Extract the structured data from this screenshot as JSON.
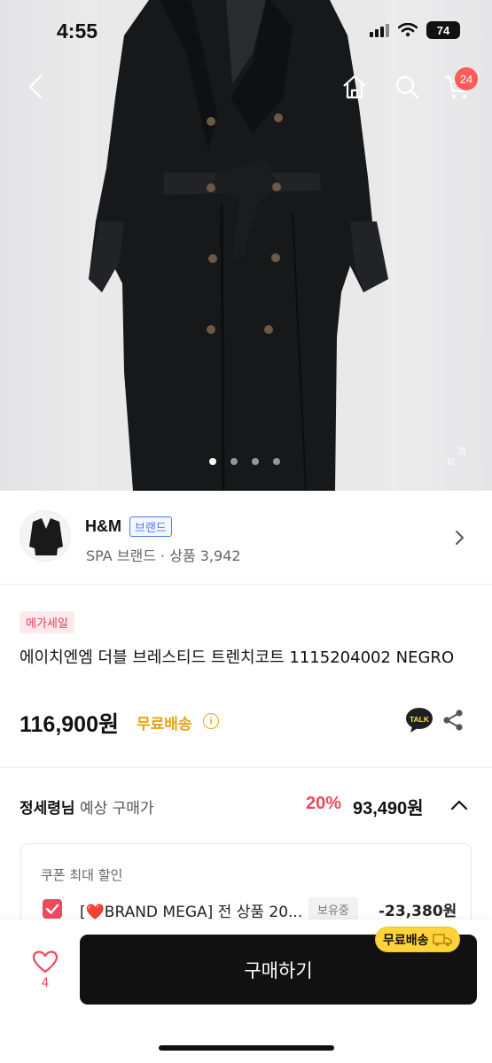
{
  "status_bar": {
    "time": "4:55",
    "battery": "74"
  },
  "header": {
    "back_icon": "chevron-left-icon",
    "home_icon": "home-icon",
    "search_icon": "search-icon",
    "cart_icon": "cart-icon",
    "cart_count": "24"
  },
  "gallery": {
    "total": 4,
    "current": 1
  },
  "brand": {
    "name": "H&M",
    "tag": "브랜드",
    "sub": "SPA 브랜드 · 상품 3,942"
  },
  "product": {
    "badge": "메가세일",
    "title": "에이치엔엠 더블 브레스티드 트렌치코트 1115204002 NEGRO",
    "price": "116,900원",
    "free_shipping": "무료배송",
    "info_icon": "ⓘ"
  },
  "expected": {
    "user": "정세령님",
    "label": "예상 구매가",
    "rate": "20%",
    "price": "93,490원"
  },
  "coupon": {
    "title": "쿠폰 최대 할인",
    "name": "[❤️BRAND MEGA] 전 상품 20...",
    "status": "보유중",
    "amount": "-23,380원"
  },
  "bottom": {
    "like_count": "4",
    "buy_label": "구매하기",
    "ship_chip": "무료배송"
  },
  "colors": {
    "accent": "#ee4a5d",
    "brand_blue": "#4a7df5",
    "ship_yellow": "#ffd43b"
  }
}
